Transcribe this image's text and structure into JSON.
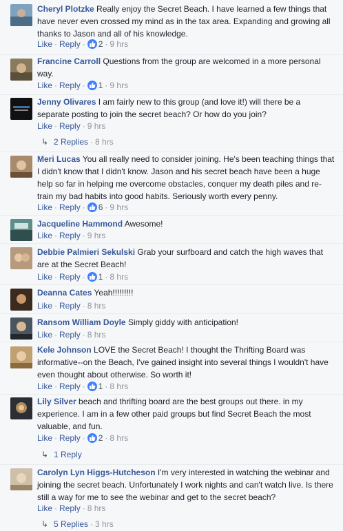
{
  "comments": [
    {
      "author": "Cheryl Plotzke",
      "text": "Really enjoy the Secret Beach. I have learned a few things that have never even crossed my mind as in the tax area. Expanding and growing all thanks to Jason and all of his knowledge.",
      "like": "Like",
      "reply": "Reply",
      "reactions": "2",
      "time": "9 hrs"
    },
    {
      "author": "Francine Carroll",
      "text": "Questions from the group are welcomed in a more personal way.",
      "like": "Like",
      "reply": "Reply",
      "reactions": "1",
      "time": "9 hrs"
    },
    {
      "author": "Jenny Olivares",
      "text": "I am fairly new to this group (and love it!) will there be a separate posting to join the secret beach? Or how do you join?",
      "like": "Like",
      "reply": "Reply",
      "time": "9 hrs",
      "replies_label": "2 Replies",
      "replies_time": "8 hrs"
    },
    {
      "author": "Meri Lucas",
      "text": "You all really need to consider joining. He's been teaching things that I didn't know that I didn't know. Jason and his secret beach have been a huge help so far in helping me overcome obstacles, conquer my death piles and re-train my bad habits into good habits. Seriously worth every penny.",
      "like": "Like",
      "reply": "Reply",
      "reactions": "6",
      "time": "9 hrs"
    },
    {
      "author": "Jacqueline Hammond",
      "text": "Awesome!",
      "like": "Like",
      "reply": "Reply",
      "time": "9 hrs"
    },
    {
      "author": "Debbie Palmieri Sekulski",
      "text": "Grab your surfboard and catch the high waves that are at the Secret Beach!",
      "like": "Like",
      "reply": "Reply",
      "reactions": "1",
      "time": "8 hrs"
    },
    {
      "author": "Deanna Cates",
      "text": "Yeah!!!!!!!!!",
      "like": "Like",
      "reply": "Reply",
      "time": "8 hrs"
    },
    {
      "author": "Ransom William Doyle",
      "text": "Simply giddy with anticipation!",
      "like": "Like",
      "reply": "Reply",
      "time": "8 hrs"
    },
    {
      "author": "Kele Johnson",
      "text": "LOVE the Secret Beach! I thought the Thrifting Board was informative--on the Beach, I've gained insight into several things I wouldn't have even thought about otherwise. So worth it!",
      "like": "Like",
      "reply": "Reply",
      "reactions": "1",
      "time": "8 hrs"
    },
    {
      "author": "Lily Silver",
      "text": "beach and thrifting board are the best groups out there. in my experience. I am in a few other paid groups but find Secret Beach the most valuable, and fun.",
      "like": "Like",
      "reply": "Reply",
      "reactions": "2",
      "time": "8 hrs",
      "replies_label": "1 Reply"
    },
    {
      "author": "Carolyn Lyn Higgs-Hutcheson",
      "text": "I'm very interested in watching the webinar and joining the secret beach. Unfortunately I work nights and can't watch live. Is there still a way for me to see the webinar and get to the secret beach?",
      "like": "Like",
      "reply": "Reply",
      "time": "8 hrs",
      "replies_label": "5 Replies",
      "replies_time": "3 hrs"
    }
  ],
  "icons": {
    "reaction": "thumbs-up-icon",
    "reply_arrow": "reply-arrow-icon"
  },
  "colors": {
    "link": "#365899",
    "meta": "#90949c",
    "reaction": "#4080ff",
    "background": "#f6f7f9"
  }
}
